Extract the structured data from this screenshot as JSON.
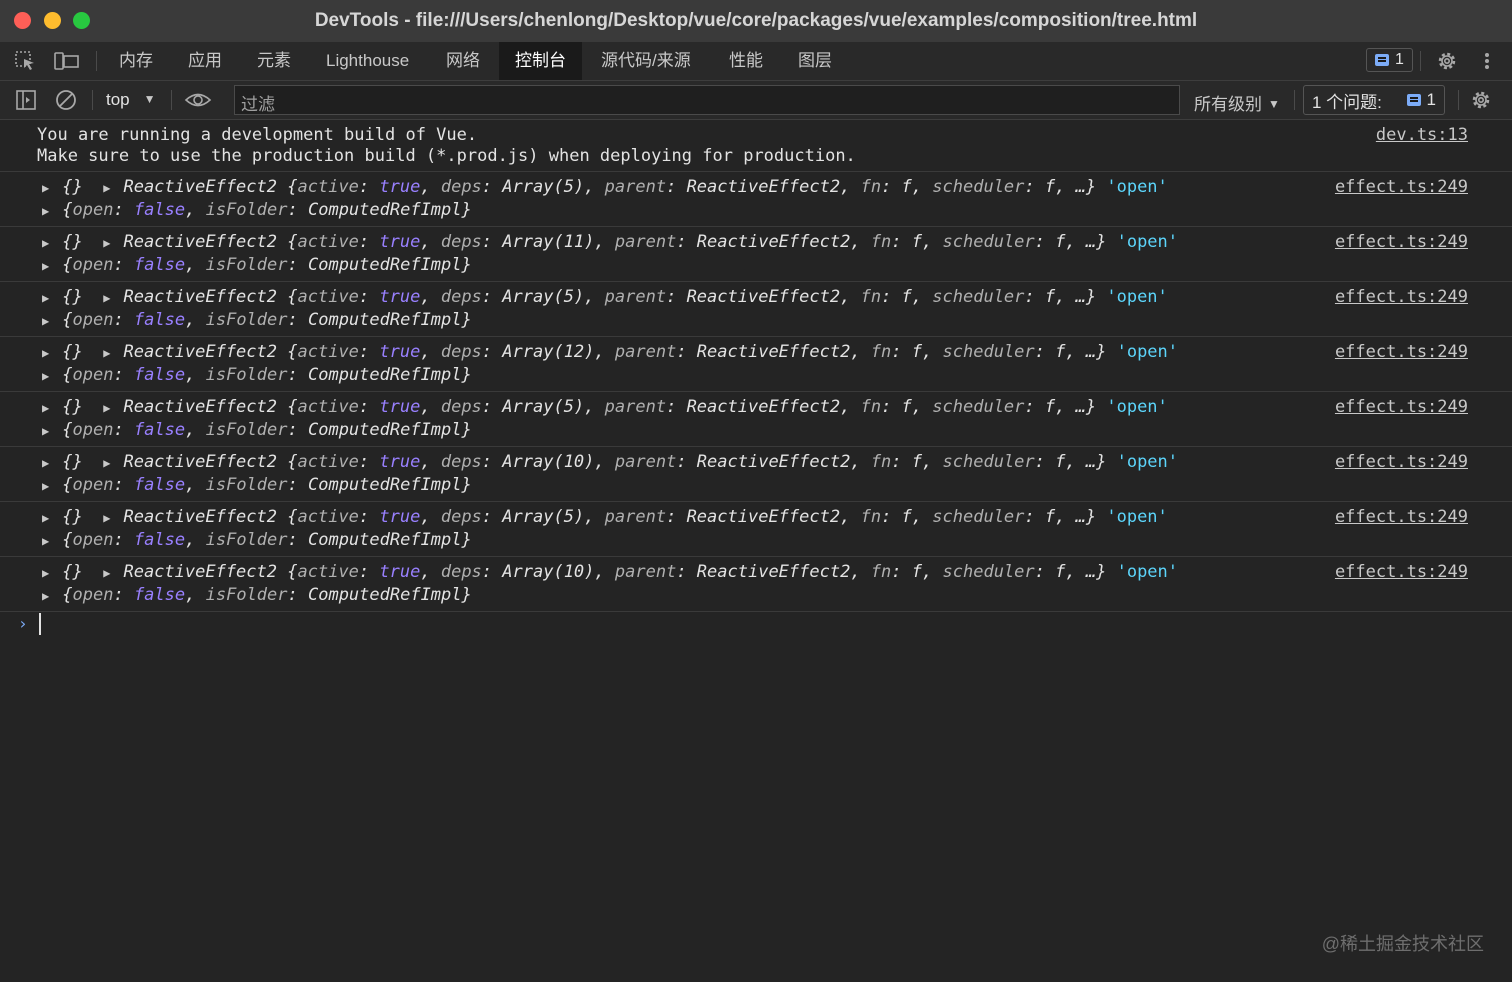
{
  "window": {
    "title": "DevTools - file:///Users/chenlong/Desktop/vue/core/packages/vue/examples/composition/tree.html"
  },
  "tabs": [
    {
      "label": "内存"
    },
    {
      "label": "应用"
    },
    {
      "label": "元素"
    },
    {
      "label": "Lighthouse"
    },
    {
      "label": "网络"
    },
    {
      "label": "控制台",
      "active": true
    },
    {
      "label": "源代码/来源"
    },
    {
      "label": "性能"
    },
    {
      "label": "图层"
    }
  ],
  "toolbar": {
    "message_count": "1"
  },
  "filterbar": {
    "context": "top",
    "filter_placeholder": "过滤",
    "levels": "所有级别",
    "issues_label": "1 个问题:",
    "issues_count": "1"
  },
  "intro": {
    "line1": "You are running a development build of Vue.",
    "line2": "Make sure to use the production build (*.prod.js) when deploying for production.",
    "source": "dev.ts:13"
  },
  "logs": [
    {
      "deps": "Array(5)",
      "source": "effect.ts:249"
    },
    {
      "deps": "Array(11)",
      "source": "effect.ts:249"
    },
    {
      "deps": "Array(5)",
      "source": "effect.ts:249"
    },
    {
      "deps": "Array(12)",
      "source": "effect.ts:249"
    },
    {
      "deps": "Array(5)",
      "source": "effect.ts:249"
    },
    {
      "deps": "Array(10)",
      "source": "effect.ts:249"
    },
    {
      "deps": "Array(5)",
      "source": "effect.ts:249"
    },
    {
      "deps": "Array(10)",
      "source": "effect.ts:249"
    }
  ],
  "log_text": {
    "empty_obj": "{}",
    "class_name": "ReactiveEffect2",
    "k_active": "active",
    "v_true": "true",
    "k_deps": "deps",
    "k_parent": "parent",
    "k_fn": "fn",
    "v_f": "f",
    "k_scheduler": "scheduler",
    "ellipsis": "…}",
    "str_open": "'open'",
    "k_open": "open",
    "v_false": "false",
    "k_isFolder": "isFolder",
    "v_computed": "ComputedRefImpl"
  },
  "prompt_symbol": "›",
  "watermark": "@稀土掘金技术社区"
}
